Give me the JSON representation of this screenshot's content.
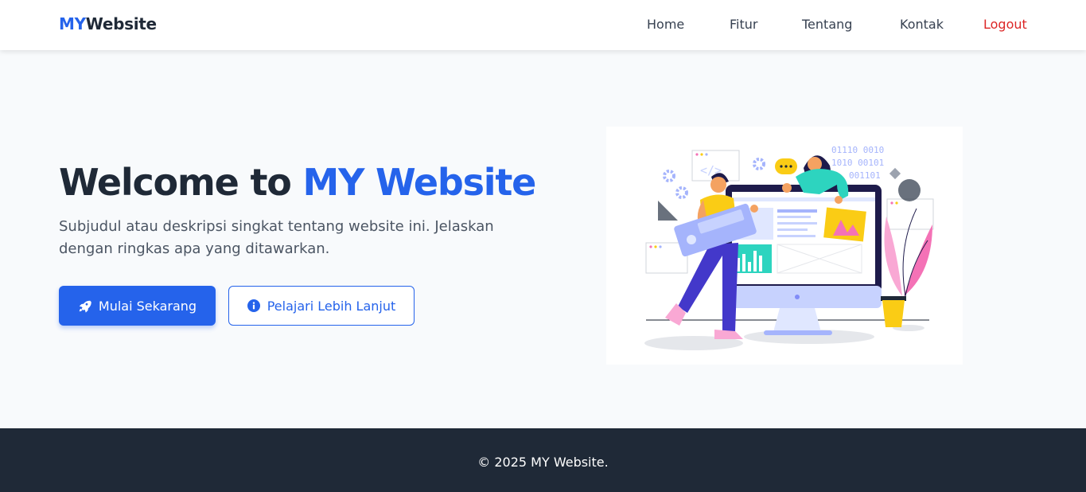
{
  "navbar": {
    "brand_prefix": "MY",
    "brand_suffix": "Website",
    "links": [
      {
        "label": "Home"
      },
      {
        "label": "Fitur"
      },
      {
        "label": "Tentang"
      },
      {
        "label": "Kontak"
      }
    ],
    "logout_label": "Logout"
  },
  "hero": {
    "title_prefix": "Welcome to ",
    "title_accent": "MY Website",
    "subtitle": "Subjudul atau deskripsi singkat tentang website ini. Jelaskan dengan ringkas apa yang ditawarkan.",
    "primary_button": {
      "label": "Mulai Sekarang",
      "icon": "rocket-icon"
    },
    "secondary_button": {
      "label": "Pelajari Lebih Lanjut",
      "icon": "info-circle-icon"
    },
    "illustration": {
      "binary_lines": [
        "01110 0010",
        "1010 00101",
        "001101"
      ]
    }
  },
  "footer": {
    "text": "© 2025 MY Website."
  },
  "colors": {
    "primary": "#2563eb",
    "dark": "#1f2937",
    "logout": "#dc2626",
    "page_bg": "#f8fafc"
  }
}
